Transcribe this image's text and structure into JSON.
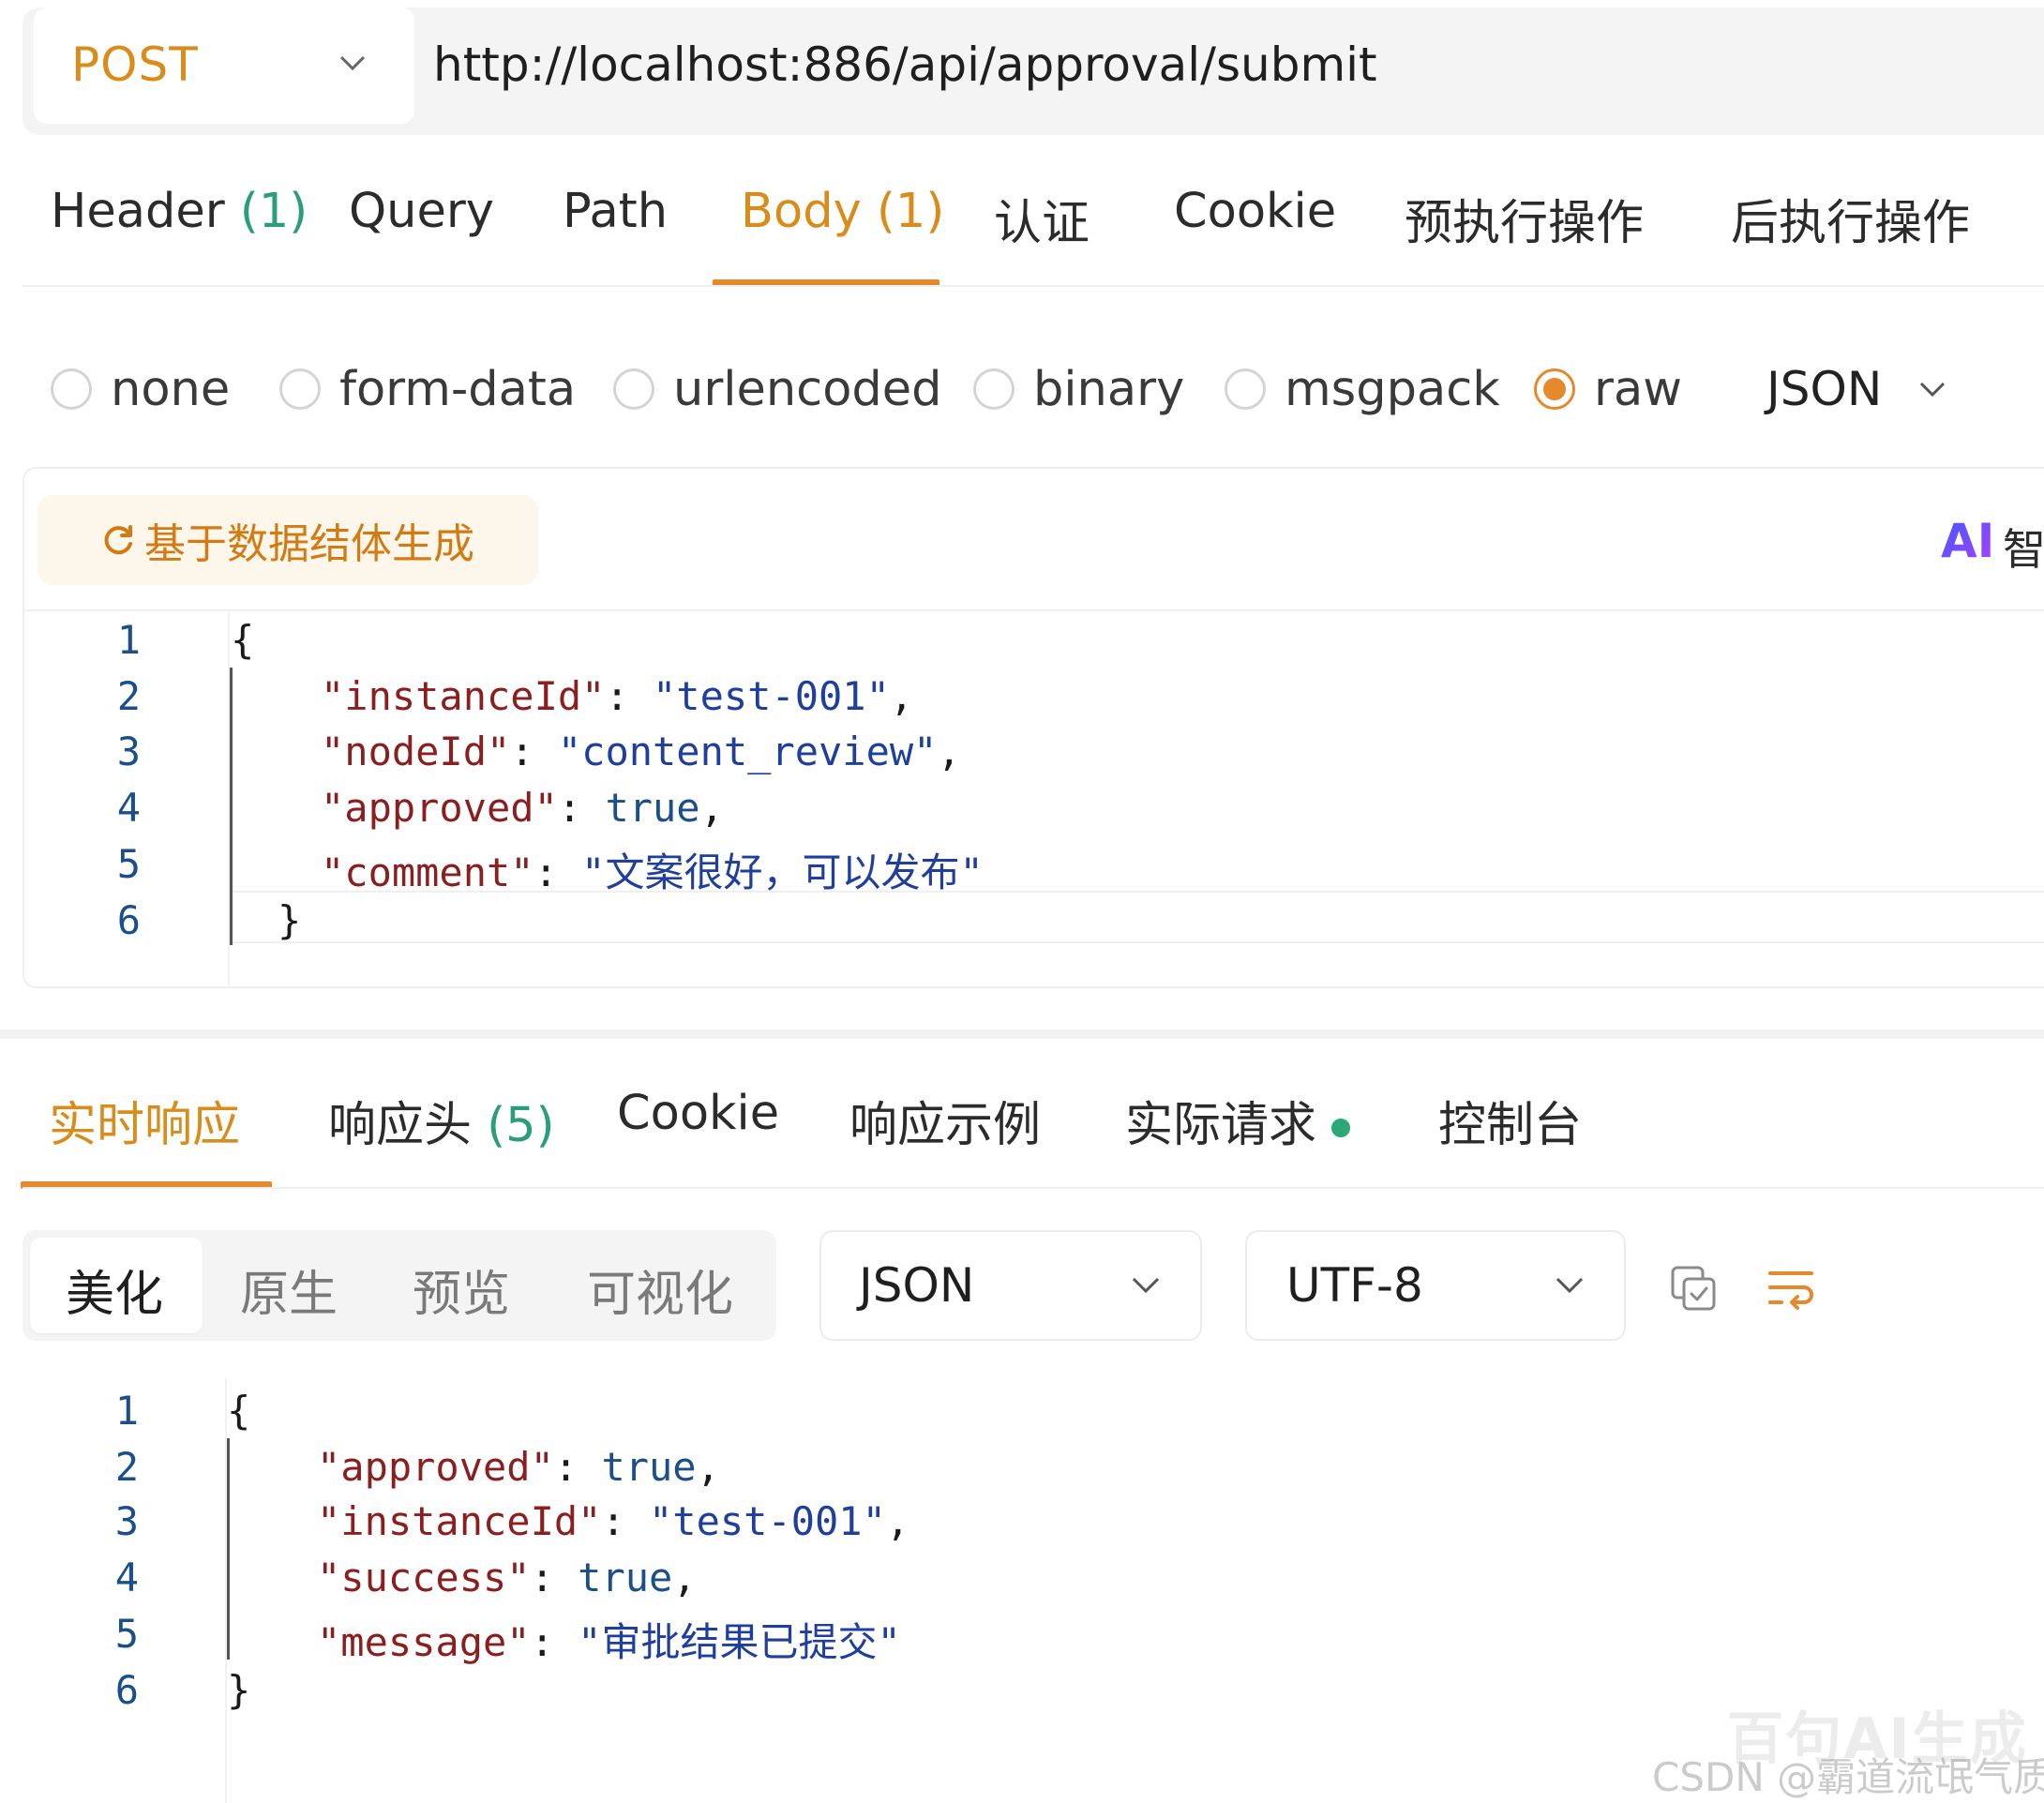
{
  "request": {
    "method": "POST",
    "url": "http://localhost:886/api/approval/submit",
    "tabs": [
      {
        "label": "Header",
        "count": "(1)"
      },
      {
        "label": "Query",
        "count": ""
      },
      {
        "label": "Path",
        "count": ""
      },
      {
        "label": "Body",
        "count": "(1)",
        "active": true
      },
      {
        "label": "认证",
        "count": ""
      },
      {
        "label": "Cookie",
        "count": ""
      },
      {
        "label": "预执行操作",
        "count": ""
      },
      {
        "label": "后执行操作",
        "count": ""
      }
    ],
    "body_types": [
      "none",
      "form-data",
      "urlencoded",
      "binary",
      "msgpack",
      "raw"
    ],
    "body_type_selected": "raw",
    "format": "JSON",
    "generate_label": "基于数据结体生成",
    "ai_label": "AI",
    "ai_text": "智",
    "line_numbers": [
      "1",
      "2",
      "3",
      "4",
      "5",
      "6"
    ],
    "code": {
      "open": "{",
      "k1": "\"instanceId\"",
      "v1": "\"test-001\"",
      "k2": "\"nodeId\"",
      "v2": "\"content_review\"",
      "k3": "\"approved\"",
      "v3": "true",
      "k4": "\"comment\"",
      "v4": "\"文案很好，可以发布\"",
      "close": "}"
    }
  },
  "response": {
    "tabs": [
      {
        "label": "实时响应",
        "count": "",
        "active": true
      },
      {
        "label": "响应头",
        "count": "(5)"
      },
      {
        "label": "Cookie",
        "count": ""
      },
      {
        "label": "响应示例",
        "count": ""
      },
      {
        "label": "实际请求",
        "count": "",
        "status_dot": true
      },
      {
        "label": "控制台",
        "count": ""
      }
    ],
    "view_modes": [
      "美化",
      "原生",
      "预览",
      "可视化"
    ],
    "view_mode_selected": "美化",
    "format": "JSON",
    "encoding": "UTF-8",
    "line_numbers": [
      "1",
      "2",
      "3",
      "4",
      "5",
      "6"
    ],
    "code": {
      "open": "{",
      "k1": "\"approved\"",
      "v1": "true",
      "k2": "\"instanceId\"",
      "v2": "\"test-001\"",
      "k3": "\"success\"",
      "v3": "true",
      "k4": "\"message\"",
      "v4": "\"审批结果已提交\"",
      "close": "}"
    }
  },
  "watermark": {
    "line1": "百句AI生成",
    "line2": "CSDN @霸道流氓气质"
  },
  "colors": {
    "accent": "#e4892c",
    "count_green": "#2a9d7a",
    "status_dot": "#2aa876"
  }
}
